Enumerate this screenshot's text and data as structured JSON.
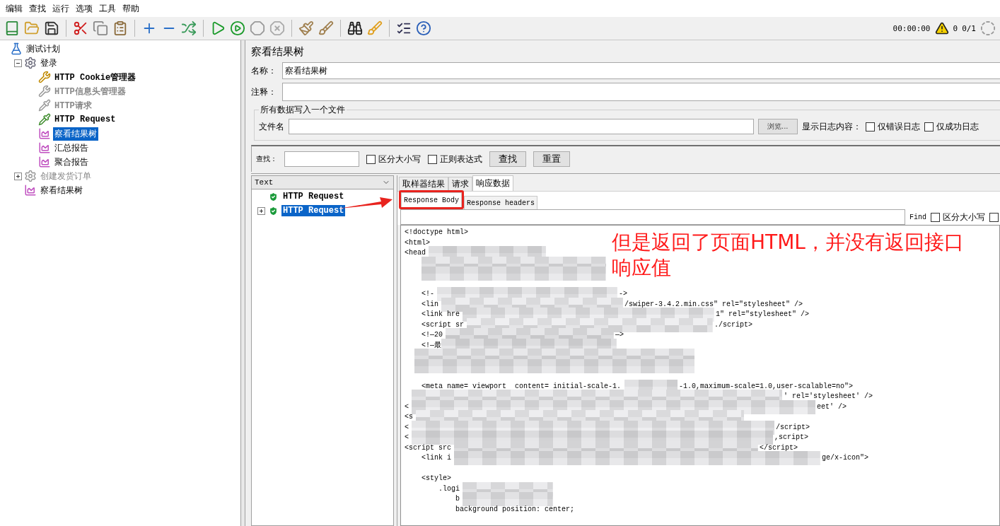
{
  "menu": [
    "编辑",
    "查找",
    "运行",
    "选项",
    "工具",
    "帮助"
  ],
  "status": {
    "timer": "00:00:00",
    "warnings": "0",
    "threads": "0/1"
  },
  "test_tree": [
    {
      "label": "测试计划",
      "kind": "plan",
      "disabled": false,
      "selected": false,
      "children": [
        {
          "label": "登录",
          "kind": "group",
          "disabled": false,
          "selected": false,
          "expanded": true,
          "children": [
            {
              "label": "HTTP Cookie管理器",
              "kind": "config",
              "disabled": false,
              "selected": false
            },
            {
              "label": "HTTP信息头管理器",
              "kind": "config",
              "disabled": true,
              "selected": false
            },
            {
              "label": "HTTP请求",
              "kind": "sampler",
              "disabled": true,
              "selected": false
            },
            {
              "label": "HTTP Request",
              "kind": "sampler",
              "disabled": false,
              "selected": false
            },
            {
              "label": "察看结果树",
              "kind": "listener",
              "disabled": false,
              "selected": true
            },
            {
              "label": "汇总报告",
              "kind": "listener",
              "disabled": false,
              "selected": false
            },
            {
              "label": "聚合报告",
              "kind": "listener",
              "disabled": false,
              "selected": false
            }
          ]
        },
        {
          "label": "创建发货订单",
          "kind": "group",
          "disabled": true,
          "selected": false,
          "expanded": false
        },
        {
          "label": "察看结果树",
          "kind": "listener",
          "disabled": false,
          "selected": false
        }
      ]
    }
  ],
  "panel": {
    "title": "察看结果树",
    "name_label": "名称：",
    "name_value": "察看结果树",
    "comment_label": "注释：",
    "file_group": {
      "legend": "所有数据写入一个文件",
      "file_label": "文件名",
      "browse": "浏览...",
      "log_label": "显示日志内容：",
      "options": [
        {
          "label": "仅错误日志",
          "checked": false
        },
        {
          "label": "仅成功日志",
          "checked": false
        }
      ]
    }
  },
  "search": {
    "label": "查找：",
    "options": [
      {
        "label": "区分大小写",
        "checked": false
      },
      {
        "label": "正则表达式",
        "checked": false
      }
    ],
    "buttons": [
      "查找",
      "重置"
    ]
  },
  "results": {
    "renderer": "Text",
    "items": [
      {
        "label": "HTTP Request",
        "selected": false,
        "expandable": false
      },
      {
        "label": "HTTP Request",
        "selected": true,
        "expandable": true
      }
    ]
  },
  "result_tabs": [
    {
      "label": "取样器结果",
      "selected": false
    },
    {
      "label": "请求",
      "selected": false
    },
    {
      "label": "响应数据",
      "selected": true
    }
  ],
  "sub_tabs": [
    {
      "label": "Response Body",
      "selected": true,
      "highlighted": true
    },
    {
      "label": "Response headers",
      "selected": false,
      "highlighted": false
    }
  ],
  "find": {
    "label": "Find",
    "options": [
      {
        "label": "区分大小写",
        "checked": false
      },
      {
        "checked": false
      }
    ]
  },
  "code_lines": [
    {
      "left": "<!doctype html>"
    },
    {
      "left": "<html>"
    },
    {
      "left": "<head"
    },
    {
      "kind": "blurred"
    },
    {
      "kind": "blurred"
    },
    {
      "kind": "blank"
    },
    {
      "left": "    <!-",
      "right": "->"
    },
    {
      "left": "    <lin",
      "right": "/swiper-3.4.2.min.css\" rel=\"stylesheet\" />"
    },
    {
      "left": "    <link hre",
      "right": "1\" rel=\"stylesheet\" />"
    },
    {
      "left": "    <script sr",
      "right": "./script>"
    },
    {
      "left": "    <!—20",
      "right": "—>"
    },
    {
      "left": "    <!—最"
    },
    {
      "kind": "blurred"
    },
    {
      "kind": "blurred"
    },
    {
      "kind": "blank"
    },
    {
      "left": "    <meta name= viewport  content= initial-scale-1.",
      "right": "-1.0,maximum-scale=1.0,user-scalable=no\">"
    },
    {
      "right": "' rel='stylesheet' />"
    },
    {
      "left": "<",
      "right": "eet' />"
    },
    {
      "left": "<s"
    },
    {
      "left": "<",
      "right": "/script>"
    },
    {
      "left": "<",
      "right": ",script>"
    },
    {
      "left": "<script src",
      "right": "</script>"
    },
    {
      "left": "    <link i",
      "right": "ge/x-icon\">"
    },
    {
      "kind": "blank"
    },
    {
      "left": "    <style>"
    },
    {
      "left": "        .logi"
    },
    {
      "left": "            b"
    },
    {
      "left": "            background position: center;"
    }
  ],
  "annotation": {
    "text": "但是返回了页面HTML，并没有返回接口响应值"
  }
}
